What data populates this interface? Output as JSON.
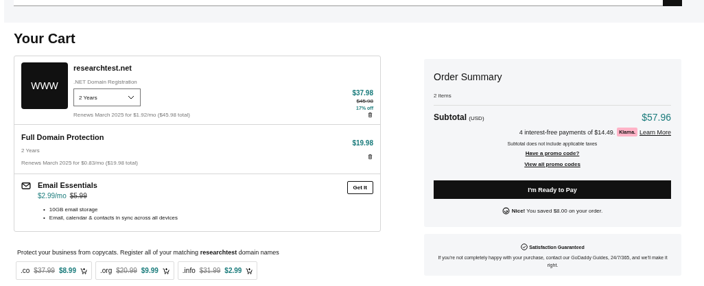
{
  "title": "Your Cart",
  "domain": {
    "logo": "WWW",
    "name": "researchtest.net",
    "type": ".NET Domain Registration",
    "term": "2 Years",
    "renewal": "Renews March 2025 for $1.92/mo ($45.98 total)",
    "price": "$37.98",
    "old_price": "$45.98",
    "discount": "17% off"
  },
  "protection": {
    "name": "Full Domain Protection",
    "term": "2 Years",
    "renewal": "Renews March 2025 for $0.83/mo ($19.98 total)",
    "price": "$19.98"
  },
  "email": {
    "name": "Email Essentials",
    "price": "$2.99/mo",
    "old_price": "$5.99",
    "button": "Get It",
    "bullet": "•",
    "features": [
      "10GB email storage",
      "Email, calendar & contacts in sync across all devices"
    ]
  },
  "upsell": {
    "text": "Protect your business from copycats. Register all of your matching **researchtest** domain names",
    "options": [
      {
        "tld": ".co",
        "old_price": "$37.99",
        "price": "$8.99"
      },
      {
        "tld": ".org",
        "old_price": "$20.99",
        "price": "$9.99"
      },
      {
        "tld": ".info",
        "old_price": "$31.99",
        "price": "$2.99"
      }
    ]
  },
  "summary": {
    "title": "Order Summary",
    "count": "2 items",
    "subtotal_label": "Subtotal",
    "currency": "(USD)",
    "subtotal": "$57.96",
    "installments": "4 interest-free payments of $14.49.",
    "klarna": "Klarna.",
    "learn_more": "Learn More",
    "tax_note": "Subtotal does not include applicable taxes",
    "promo": "Have a promo code?",
    "all_promos": "View all promo codes",
    "pay_button": "I'm Ready to Pay",
    "savings": "**Nice!** You saved $8.00 on your order."
  },
  "guarantee": {
    "title": "Satisfaction Guaranteed",
    "text": "If you're not completely happy with your purchase, contact our GoDaddy Guides, 24/7/365, and we'll make it right."
  }
}
